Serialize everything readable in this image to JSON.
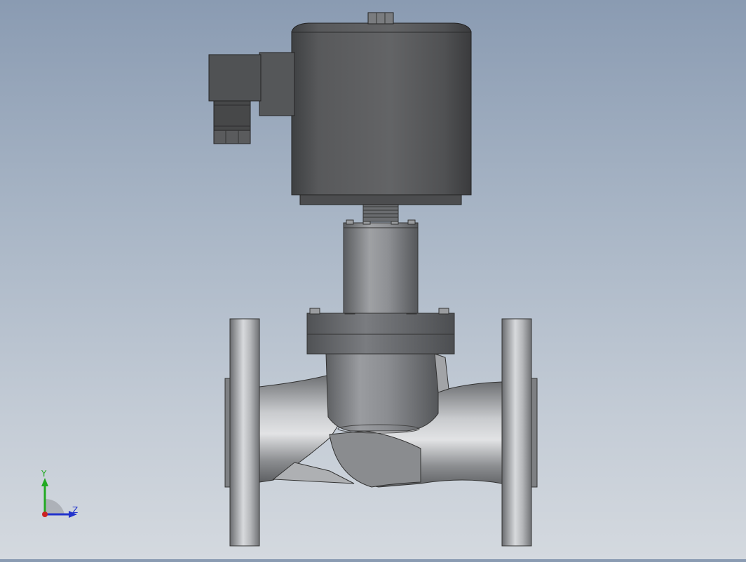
{
  "viewport": {
    "background_top": "#8a9bb2",
    "background_bottom": "#d4d9df"
  },
  "model": {
    "name": "solenoid valve",
    "coil_color": "#5a5c5f",
    "body_color": "#8d8f92"
  },
  "triad": {
    "y_label": "Y",
    "z_label": "Z",
    "y_color": "#22aa22",
    "z_color": "#2233cc",
    "x_color": "#cc2222"
  }
}
